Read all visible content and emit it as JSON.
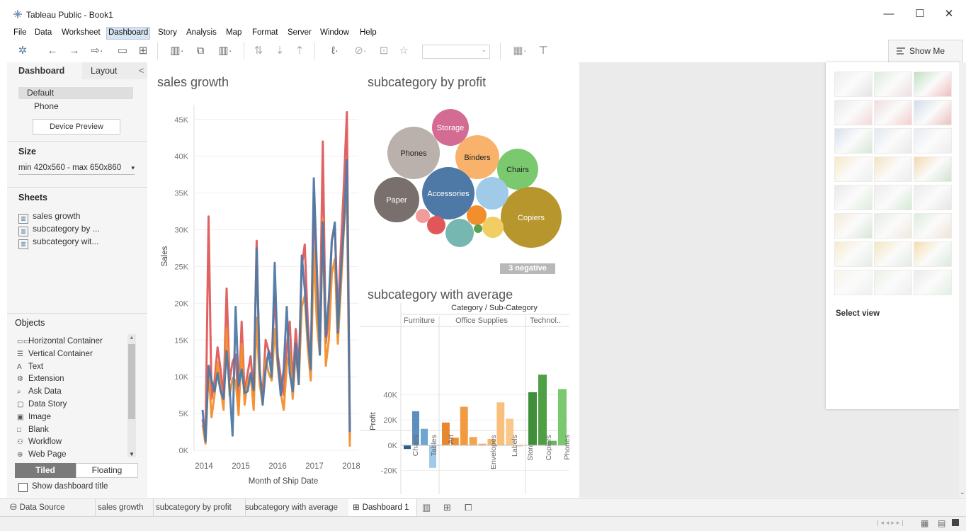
{
  "window": {
    "title": "Tableau Public - Book1",
    "minimize": "—",
    "maximize": "☐",
    "close": "✕"
  },
  "menu": [
    "File",
    "Data",
    "Worksheet",
    "Dashboard",
    "Story",
    "Analysis",
    "Map",
    "Format",
    "Server",
    "Window",
    "Help"
  ],
  "menu_active": "Dashboard",
  "showme": {
    "label": "Show Me",
    "select_view": "Select view"
  },
  "left": {
    "tab_dashboard": "Dashboard",
    "tab_layout": "Layout",
    "collapse": "<",
    "device_default": "Default",
    "device_phone": "Phone",
    "device_preview": "Device Preview",
    "size_title": "Size",
    "size_value": "min 420x560 - max 650x860",
    "sheets_title": "Sheets",
    "sheets": [
      "sales growth",
      "subcategory by ...",
      "subcategory wit..."
    ],
    "objects_title": "Objects",
    "objects": [
      {
        "icon": "▭▭",
        "label": "Horizontal Container"
      },
      {
        "icon": "☰",
        "label": "Vertical Container"
      },
      {
        "icon": "A",
        "label": "Text"
      },
      {
        "icon": "⚙",
        "label": "Extension"
      },
      {
        "icon": "⌕",
        "label": "Ask Data"
      },
      {
        "icon": "▢",
        "label": "Data Story"
      },
      {
        "icon": "▣",
        "label": "Image"
      },
      {
        "icon": "□",
        "label": "Blank"
      },
      {
        "icon": "⚇",
        "label": "Workflow"
      },
      {
        "icon": "⊕",
        "label": "Web Page"
      }
    ],
    "tiled": "Tiled",
    "floating": "Floating",
    "show_title": "Show dashboard title"
  },
  "charts": {
    "sales_growth_title": "sales growth",
    "bubble_title": "subcategory by profit",
    "bar_title": "subcategory with average",
    "negative_badge": "3 negative"
  },
  "chart_data": [
    {
      "type": "line",
      "title": "sales growth",
      "xlabel": "Month of Ship Date",
      "ylabel": "Sales",
      "x_ticks": [
        "2014",
        "2015",
        "2016",
        "2017",
        "2018"
      ],
      "y_ticks": [
        "0K",
        "5K",
        "10K",
        "15K",
        "20K",
        "25K",
        "30K",
        "35K",
        "40K",
        "45K"
      ],
      "ylim": [
        0,
        47000
      ],
      "x": [
        0,
        1,
        2,
        3,
        4,
        5,
        6,
        7,
        8,
        9,
        10,
        11,
        12,
        13,
        14,
        15,
        16,
        17,
        18,
        19,
        20,
        21,
        22,
        23,
        24,
        25,
        26,
        27,
        28,
        29,
        30,
        31,
        32,
        33,
        34,
        35,
        36,
        37,
        38,
        39,
        40,
        41,
        42,
        43,
        44,
        45,
        46,
        47,
        48,
        49
      ],
      "series": [
        {
          "color": "#e05a5a",
          "values": [
            4200,
            1800,
            31800,
            7000,
            9500,
            14000,
            11000,
            7200,
            22000,
            9500,
            12000,
            13000,
            6000,
            17500,
            7800,
            10500,
            12800,
            7500,
            28500,
            10000,
            7800,
            15000,
            13500,
            12500,
            21000,
            13000,
            10000,
            7500,
            14000,
            17500,
            9000,
            16500,
            11000,
            25000,
            28000,
            17500,
            11000,
            35000,
            21000,
            16000,
            42000,
            14500,
            18500,
            28500,
            30500,
            18000,
            27500,
            36000,
            46000,
            1500
          ]
        },
        {
          "color": "#f28e2b",
          "values": [
            3500,
            900,
            11000,
            4500,
            7600,
            12000,
            8500,
            5500,
            16500,
            7500,
            9800,
            9500,
            4800,
            14500,
            6200,
            9500,
            10300,
            5500,
            18000,
            9000,
            6400,
            12500,
            10500,
            9500,
            16500,
            11500,
            7800,
            5500,
            11500,
            13500,
            7000,
            13500,
            9000,
            19500,
            21000,
            14000,
            9500,
            27500,
            17500,
            13000,
            31500,
            11500,
            15000,
            24000,
            26000,
            14500,
            22000,
            30000,
            36000,
            500
          ]
        },
        {
          "color": "#4e79a7",
          "values": [
            5500,
            1200,
            11500,
            9500,
            8000,
            10500,
            8000,
            7000,
            13500,
            8500,
            2000,
            19500,
            8800,
            11000,
            7800,
            8000,
            10500,
            8200,
            27500,
            11000,
            6200,
            11000,
            13500,
            10000,
            25500,
            12500,
            7500,
            11000,
            19500,
            10500,
            8000,
            14500,
            9000,
            26500,
            22000,
            15500,
            11000,
            37000,
            25000,
            13000,
            31000,
            15500,
            20500,
            28500,
            31000,
            16000,
            24000,
            30500,
            39500,
            2500
          ]
        }
      ]
    },
    {
      "type": "scatter",
      "title": "subcategory by profit",
      "note": "packed bubbles",
      "bubbles": [
        {
          "label": "Storage",
          "color": "#d36b93"
        },
        {
          "label": "Phones",
          "color": "#bab0ac"
        },
        {
          "label": "Binders",
          "color": "#f9b26b"
        },
        {
          "label": "Chairs",
          "color": "#7bc96f"
        },
        {
          "label": "Paper",
          "color": "#79706e"
        },
        {
          "label": "Accessories",
          "color": "#4e79a7"
        },
        {
          "label": "Copiers",
          "color": "#b8962e"
        },
        {
          "label": "",
          "color": "#9fcbe8"
        },
        {
          "label": "",
          "color": "#f28e2b"
        },
        {
          "label": "",
          "color": "#e15759"
        },
        {
          "label": "",
          "color": "#76b7b2"
        },
        {
          "label": "",
          "color": "#f1ce63"
        },
        {
          "label": "",
          "color": "#f09c9c"
        },
        {
          "label": "",
          "color": "#59a14f"
        }
      ]
    },
    {
      "type": "bar",
      "title": "subcategory with average",
      "header": "Category / Sub-Category",
      "ylabel": "Profit",
      "y_ticks": [
        "-20K",
        "0K",
        "20K",
        "40K"
      ],
      "ylim": [
        -22000,
        60000
      ],
      "groups": [
        {
          "name": "Furniture",
          "labels": [
            "Chairs",
            "Tables"
          ],
          "values": [
            -3000,
            27000,
            13000,
            -18000
          ],
          "colors": [
            "#2b5f8f",
            "#5b8fc0",
            "#6fa5d2",
            "#9fcbe8"
          ]
        },
        {
          "name": "Office Supplies",
          "labels": [
            "Art",
            "Envelopes",
            "Labels",
            "Storage"
          ],
          "values": [
            18000,
            6000,
            30500,
            6500,
            1200,
            5000,
            34000,
            21000,
            -1000
          ],
          "colors": [
            "#e8872d",
            "#f08f32",
            "#f29a40",
            "#f3a350",
            "#f5ad60",
            "#f7b66e",
            "#f9bf7d",
            "#fac78b",
            "#fbd09a"
          ]
        },
        {
          "name": "Technol..",
          "labels": [
            "Copiers",
            "Phones"
          ],
          "values": [
            42000,
            56000,
            3500,
            44500
          ],
          "colors": [
            "#3f8f3a",
            "#4ea044",
            "#6cb35f",
            "#7bc96f"
          ]
        }
      ]
    }
  ],
  "bottom_tabs": [
    "Data Source",
    "sales growth",
    "subcategory by profit",
    "subcategory with average",
    "Dashboard 1"
  ],
  "bottom_active": "Dashboard 1"
}
